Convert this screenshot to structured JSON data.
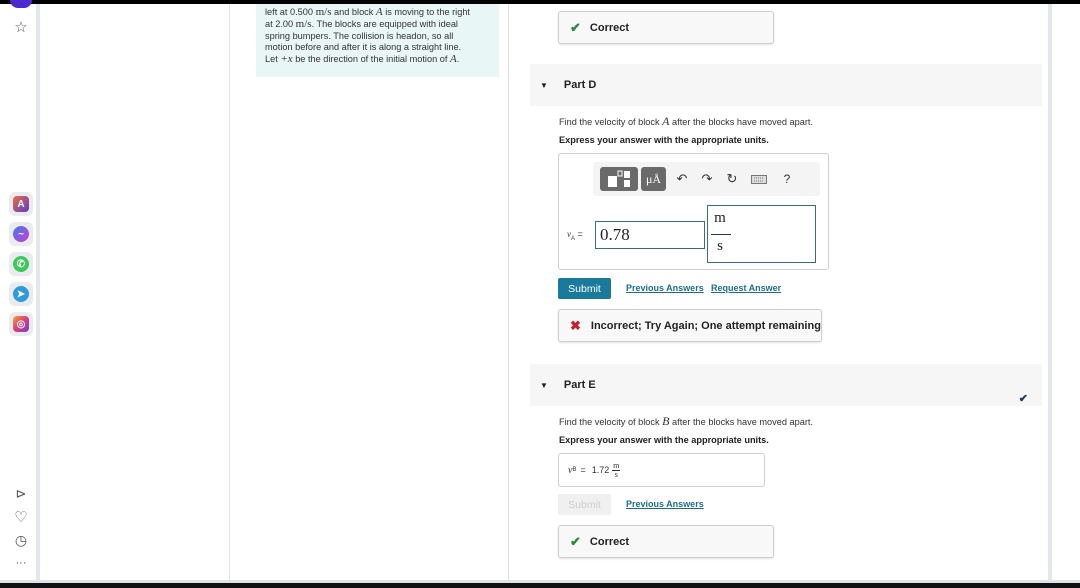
{
  "sidebar": {
    "top_icons": [
      "star-icon"
    ],
    "apps": [
      {
        "name": "app-arc",
        "color": "#e24c3b"
      },
      {
        "name": "messenger",
        "color": "#a23be0"
      },
      {
        "name": "whatsapp",
        "color": "#3cc85a"
      },
      {
        "name": "telegram",
        "color": "#2f9ad8"
      },
      {
        "name": "instagram",
        "color": "#d93d7a"
      }
    ],
    "bottom_icons": [
      "play-icon",
      "heart-icon",
      "clock-icon",
      "more-icon"
    ],
    "more_label": "···"
  },
  "problem": {
    "line1_pre": "left at 0.500 ",
    "line1_unit": "m/s",
    "line1_mid": " and block ",
    "line1_var": "A",
    "line1_post": " is moving to the right",
    "line2_pre": "at 2.00 ",
    "line2_unit": "m/s",
    "line2_post": ". The blocks are equipped with ideal",
    "line3": "spring bumpers. The collision is headon, so all",
    "line4": "motion before and after it is along a straight line.",
    "line5_pre": "Let ",
    "line5_var": "+x",
    "line5_mid": " be the direction of the initial motion of ",
    "line5_var2": "A",
    "line5_post": "."
  },
  "part_c": {
    "feedback_label": "Correct"
  },
  "part_d": {
    "title": "Part D",
    "question_pre": "Find the velocity of block ",
    "question_var": "A",
    "question_post": " after the blocks have moved apart.",
    "instruction": "Express your answer with the appropriate units.",
    "toolbar": {
      "template_icon": "template-icon",
      "units_label": "μÅ",
      "undo_icon": "undo-icon",
      "redo_icon": "redo-icon",
      "reset_icon": "reset-icon",
      "keyboard_icon": "keyboard-icon",
      "help_label": "?"
    },
    "var_name": "v",
    "var_sub": "A",
    "equals": "=",
    "value": "0.78",
    "unit_numerator": "m",
    "unit_denominator": "s",
    "submit_label": "Submit",
    "previous_answers_label": "Previous Answers",
    "request_answer_label": "Request Answer",
    "feedback_label": "Incorrect; Try Again; One attempt remaining",
    "feedback_color": "#c8202c"
  },
  "part_e": {
    "title": "Part E",
    "question_pre": "Find the velocity of block ",
    "question_var": "B",
    "question_post": " after the blocks have moved apart.",
    "instruction": "Express your answer with the appropriate units.",
    "var_name": "v",
    "var_sub": "B",
    "equals": "=",
    "value": "1.72",
    "unit_numerator": "m",
    "unit_denominator": "s",
    "submit_label": "Submit",
    "previous_answers_label": "Previous Answers",
    "feedback_label": "Correct",
    "feedback_color": "#2e8b3e"
  },
  "colors": {
    "accent": "#1a7a9c",
    "correct": "#2e8b3e",
    "incorrect": "#c8202c",
    "problem_bg": "#e8f6f6"
  }
}
